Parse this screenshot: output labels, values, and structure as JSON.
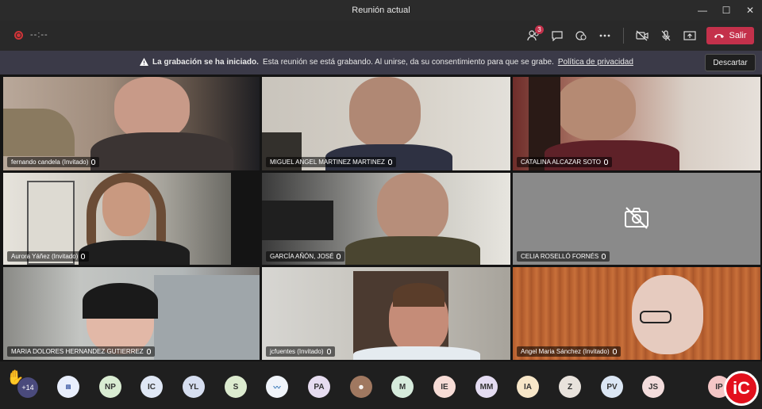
{
  "window": {
    "title": "Reunión actual",
    "minimize": "—",
    "maximize": "☐",
    "close": "✕"
  },
  "toolbar": {
    "timer": "--:--",
    "participants_badge": "3",
    "leave_label": "Salir"
  },
  "banner": {
    "title": "La grabación se ha iniciado.",
    "message": "Esta reunión se está grabando. Al unirse, da su consentimiento para que se grabe.",
    "link": "Política de privacidad",
    "dismiss": "Descartar"
  },
  "participants": [
    {
      "name": "fernando candela (Invitado)"
    },
    {
      "name": "MIGUEL ANGEL MARTINEZ MARTINEZ"
    },
    {
      "name": "CATALINA ALCAZAR SOTO"
    },
    {
      "name": "Aurora Yáñez (Invitado)"
    },
    {
      "name": "GARCÍA AÑÓN, JOSÉ"
    },
    {
      "name": "CELIA ROSELLÓ FORNÉS"
    },
    {
      "name": "MARIA DOLORES HERNANDEZ GUTIERREZ"
    },
    {
      "name": "jcfuentes (Invitado)"
    },
    {
      "name": "Angel Maria Sánchez (Invitado)"
    }
  ],
  "bottom": {
    "more_count": "+14",
    "avatars": [
      "",
      "NP",
      "IC",
      "YL",
      "S",
      "",
      "PA",
      "",
      "M",
      "IE",
      "MM",
      "IA",
      "Z",
      "PV",
      "JS"
    ],
    "last": "IP",
    "logo": "iC"
  },
  "colors": {
    "leave": "#c4314b",
    "banner": "#3b3a48"
  }
}
